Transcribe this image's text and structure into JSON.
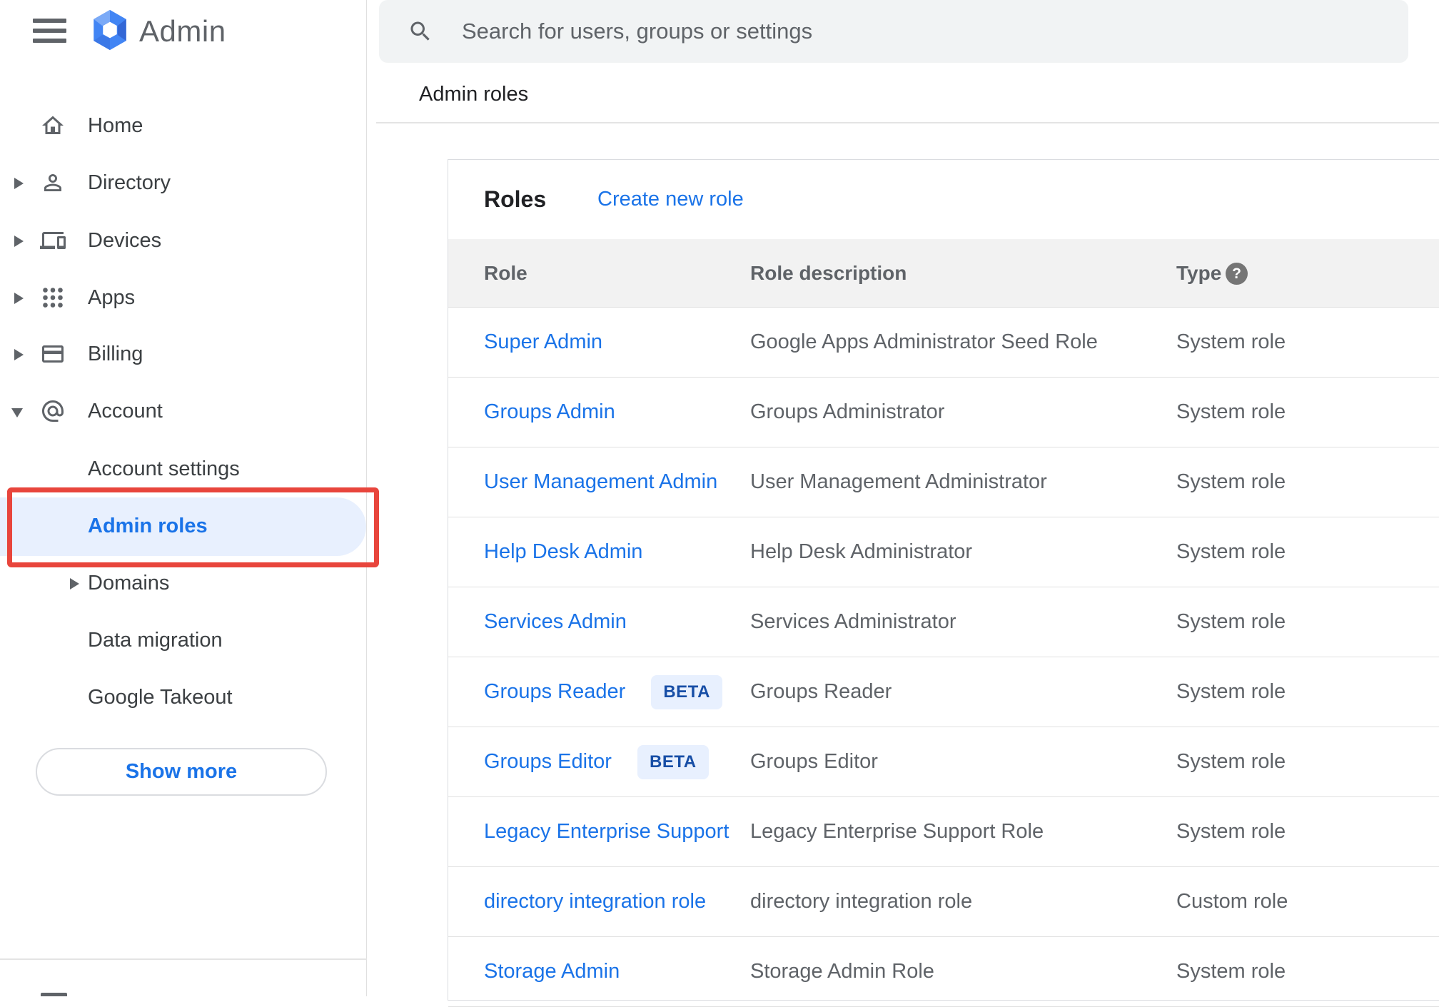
{
  "app": {
    "title": "Admin"
  },
  "search": {
    "placeholder": "Search for users, groups or settings"
  },
  "breadcrumb": "Admin roles",
  "sidebar": {
    "items": [
      {
        "label": "Home"
      },
      {
        "label": "Directory"
      },
      {
        "label": "Devices"
      },
      {
        "label": "Apps"
      },
      {
        "label": "Billing"
      },
      {
        "label": "Account"
      }
    ],
    "account_subitems": [
      {
        "label": "Account settings"
      },
      {
        "label": "Admin roles",
        "selected": true
      },
      {
        "label": "Domains"
      },
      {
        "label": "Data migration"
      },
      {
        "label": "Google Takeout"
      }
    ],
    "show_more_label": "Show more"
  },
  "main": {
    "card_title": "Roles",
    "create_link": "Create new role",
    "table": {
      "columns": {
        "role": "Role",
        "description": "Role description",
        "type": "Type"
      },
      "rows": [
        {
          "role": "Super Admin",
          "description": "Google Apps Administrator Seed Role",
          "type": "System role"
        },
        {
          "role": "Groups Admin",
          "description": "Groups Administrator",
          "type": "System role"
        },
        {
          "role": "User Management Admin",
          "description": "User Management Administrator",
          "type": "System role"
        },
        {
          "role": "Help Desk Admin",
          "description": "Help Desk Administrator",
          "type": "System role"
        },
        {
          "role": "Services Admin",
          "description": "Services Administrator",
          "type": "System role"
        },
        {
          "role": "Groups Reader",
          "beta_label": "BETA",
          "description": "Groups Reader",
          "type": "System role"
        },
        {
          "role": "Groups Editor",
          "beta_label": "BETA",
          "description": "Groups Editor",
          "type": "System role"
        },
        {
          "role": "Legacy Enterprise Support",
          "description": "Legacy Enterprise Support Role",
          "type": "System role"
        },
        {
          "role": "directory integration role",
          "description": "directory integration role",
          "type": "Custom role"
        },
        {
          "role": "Storage Admin",
          "description": "Storage Admin Role",
          "type": "System role"
        }
      ]
    }
  },
  "colors": {
    "accent_blue": "#1a73e8",
    "selected_bg": "#e8f0fe",
    "annotation_red": "#e8453c",
    "beta_text": "#174ea6",
    "header_gray_bg": "#f2f2f2",
    "search_bg": "#f1f3f4",
    "icon_gray": "#5f6368"
  }
}
